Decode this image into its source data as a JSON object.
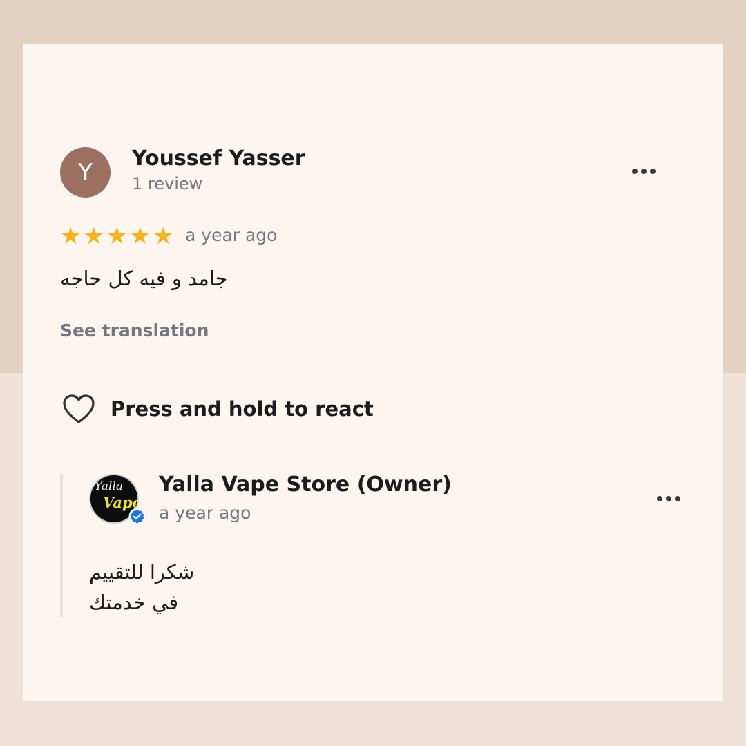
{
  "review": {
    "avatar_initial": "Y",
    "reviewer_name": "Youssef Yasser",
    "review_count": "1 review",
    "rating": 5,
    "rating_max": 5,
    "time": "a year ago",
    "text": "جامد و فيه كل حاجه",
    "see_translation": "See translation",
    "more_icon": "more-horizontal-icon"
  },
  "reaction": {
    "icon": "heart-outline-icon",
    "label": "Press and hold to react"
  },
  "owner_reply": {
    "name": "Yalla Vape Store (Owner)",
    "time": "a year ago",
    "logo_line1": "Yalla",
    "logo_line2": "Vape",
    "verified_icon": "verified-badge-icon",
    "more_icon": "more-horizontal-icon",
    "text_lines": [
      "شكرا للتقييم",
      "في خدمتك"
    ]
  },
  "colors": {
    "star": "#f8b21b",
    "avatar_bg": "#9c7060",
    "verified": "#1a73e8",
    "muted_text": "#74777d"
  }
}
